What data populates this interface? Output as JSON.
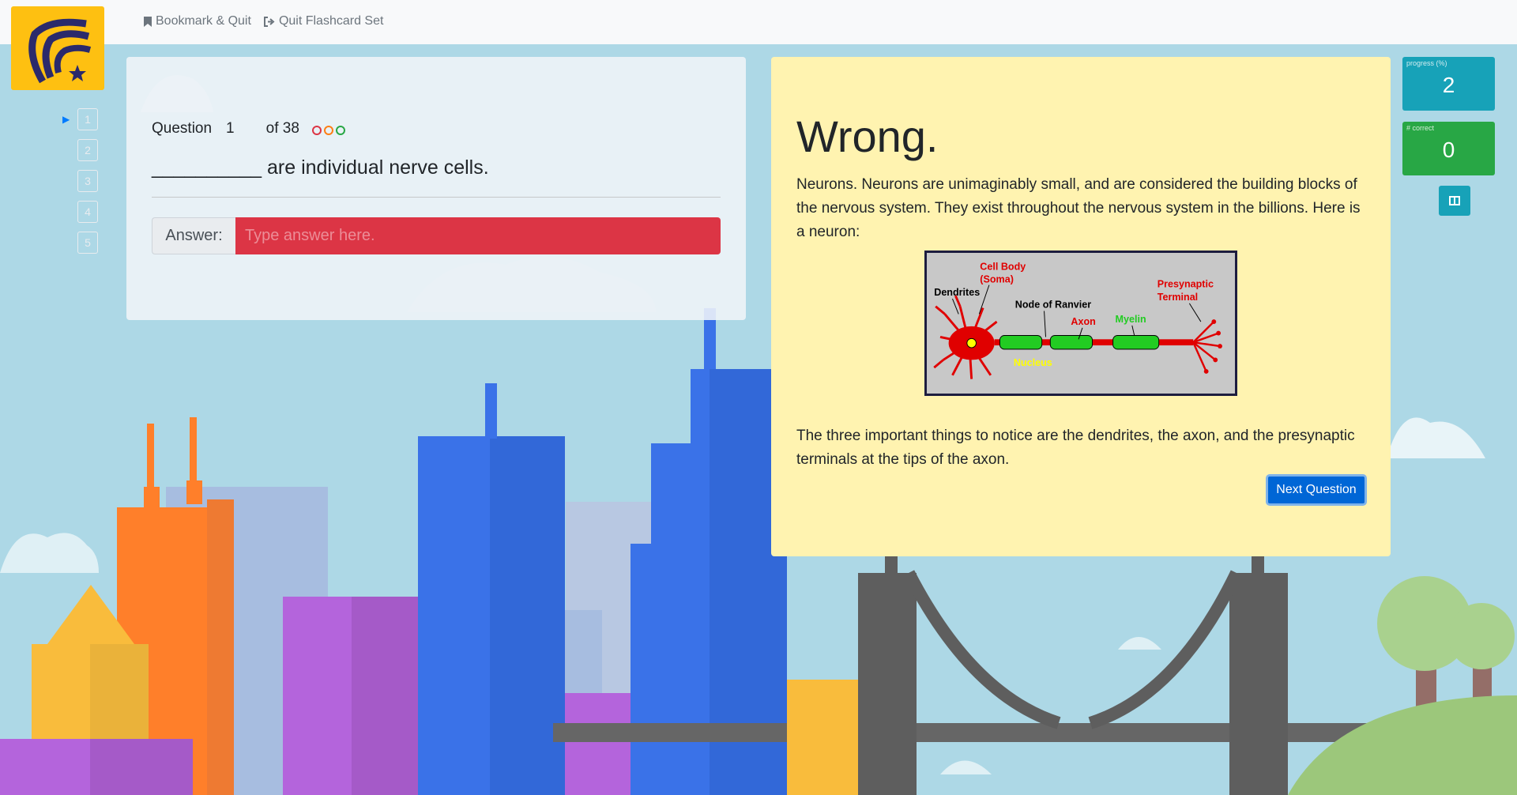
{
  "nav": {
    "bookmark_label": "Bookmark & Quit",
    "quit_label": "Quit Flashcard Set"
  },
  "question_list": [
    "1",
    "2",
    "3",
    "4",
    "5"
  ],
  "question": {
    "label": "Question",
    "number": "1",
    "of_text": "of 38",
    "text": "__________ are individual nerve cells.",
    "answer_label": "Answer:",
    "answer_placeholder": "Type answer here."
  },
  "attempt_dots": [
    "#dc3545",
    "#fd7e14",
    "#28a745"
  ],
  "feedback": {
    "title": "Wrong.",
    "text1": "Neurons. Neurons are unimaginably small, and are considered the building blocks of the nervous system. They exist throughout the nervous system in the billions. Here is a neuron:",
    "text2": "The three important things to notice are the dendrites, the axon, and the presynaptic terminals at the tips of the axon.",
    "next_label": "Next Question",
    "diagram_labels": {
      "cell_body": "Cell Body",
      "soma": "(Soma)",
      "dendrites": "Dendrites",
      "node": "Node of Ranvier",
      "axon": "Axon",
      "myelin": "Myelin",
      "presynaptic": "Presynaptic",
      "terminal": "Terminal",
      "nucleus": "Nucleus"
    }
  },
  "stats": {
    "progress_label": "progress (%)",
    "progress_value": "2",
    "correct_label": "# correct",
    "correct_value": "0"
  },
  "colors": {
    "logo_bg": "#fec011",
    "wrong_input": "#dc3545",
    "feedback_bg": "#fff3b0",
    "progress": "#17a2b8",
    "correct": "#28a745",
    "next_button": "#0066d6"
  },
  "icons": {
    "bookmark": "bookmark-icon",
    "quit": "sign-out-icon",
    "layout": "columns-icon",
    "current": "play-arrow-icon"
  }
}
